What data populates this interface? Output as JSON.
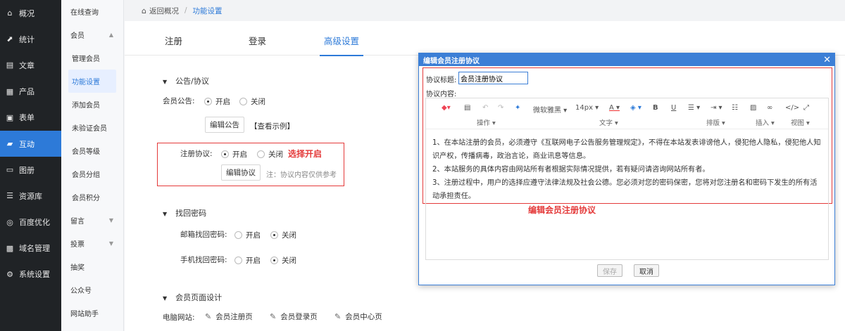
{
  "nav": [
    {
      "icon": "home-icon",
      "glyph": "⌂",
      "label": "概况"
    },
    {
      "icon": "stats-icon",
      "glyph": "⬈",
      "label": "统计"
    },
    {
      "icon": "article-icon",
      "glyph": "▤",
      "label": "文章"
    },
    {
      "icon": "product-icon",
      "glyph": "▦",
      "label": "产品"
    },
    {
      "icon": "form-icon",
      "glyph": "▣",
      "label": "表单"
    },
    {
      "icon": "chat-icon",
      "glyph": "▰",
      "label": "互动",
      "active": true
    },
    {
      "icon": "album-icon",
      "glyph": "▭",
      "label": "图册"
    },
    {
      "icon": "database-icon",
      "glyph": "☰",
      "label": "资源库"
    },
    {
      "icon": "seo-icon",
      "glyph": "◎",
      "label": "百度优化"
    },
    {
      "icon": "domain-icon",
      "glyph": "▩",
      "label": "域名管理"
    },
    {
      "icon": "gear-icon",
      "glyph": "⚙",
      "label": "系统设置"
    }
  ],
  "submenu": [
    {
      "label": "在线查询"
    },
    {
      "label": "会员",
      "arrow": "▲"
    },
    {
      "label": "管理会员",
      "child": true
    },
    {
      "label": "功能设置",
      "child": true,
      "active": true
    },
    {
      "label": "添加会员",
      "child": true
    },
    {
      "label": "未验证会员",
      "child": true
    },
    {
      "label": "会员等级",
      "child": true
    },
    {
      "label": "会员分组",
      "child": true
    },
    {
      "label": "会员积分",
      "child": true
    },
    {
      "label": "留言",
      "arrow": "▼"
    },
    {
      "label": "投票",
      "arrow": "▼"
    },
    {
      "label": "抽奖"
    },
    {
      "label": "公众号"
    },
    {
      "label": "网站助手"
    }
  ],
  "breadcrumb": {
    "back": "返回概况",
    "sep": "/",
    "current": "功能设置"
  },
  "tabs": [
    "注册",
    "登录",
    "高级设置"
  ],
  "notice": {
    "section": "公告/协议",
    "announce_label": "会员公告:",
    "on": "开启",
    "off": "关闭",
    "edit_announce": "编辑公告",
    "view_example": "【查看示例】",
    "agreement_label": "注册协议:",
    "edit_agreement": "编辑协议",
    "agreement_hint": "注：协议内容仅供参考",
    "annotation": "选择开启"
  },
  "password": {
    "section": "找回密码",
    "email_label": "邮箱找回密码:",
    "phone_label": "手机找回密码:",
    "on": "开启",
    "off": "关闭"
  },
  "design": {
    "section": "会员页面设计",
    "pc_label": "电脑网站:",
    "pages": [
      "会员注册页",
      "会员登录页",
      "会员中心页"
    ]
  },
  "dialog": {
    "title": "编辑会员注册协议",
    "close": "✕",
    "title_label": "协议标题:",
    "title_value": "会员注册协议",
    "content_label": "协议内容:",
    "toolbar": {
      "font": "微软雅黑",
      "size": "14px",
      "groups": [
        "操作",
        "文字",
        "排版",
        "插入",
        "视图"
      ]
    },
    "paragraphs": [
      "1、在本站注册的会员，必须遵守《互联网电子公告服务管理规定》，不得在本站发表诽谤他人，侵犯他人隐私，侵犯他人知识产权，传播病毒，政治言论，商业讯息等信息。",
      "2、本站服务的具体内容由网站所有者根据实际情况提供，若有疑问请咨询网站所有者。",
      "3、注册过程中，用户的选择应遵守法律法规及社会公德。您必须对您的密码保密，您将对您注册名和密码下发生的所有活动承担责任。"
    ],
    "annotation": "编辑会员注册协议",
    "save": "保存",
    "cancel": "取消"
  },
  "colors": {
    "accent": "#2d7ad8",
    "annotation": "#e43a3a",
    "sidebar": "#202326"
  }
}
